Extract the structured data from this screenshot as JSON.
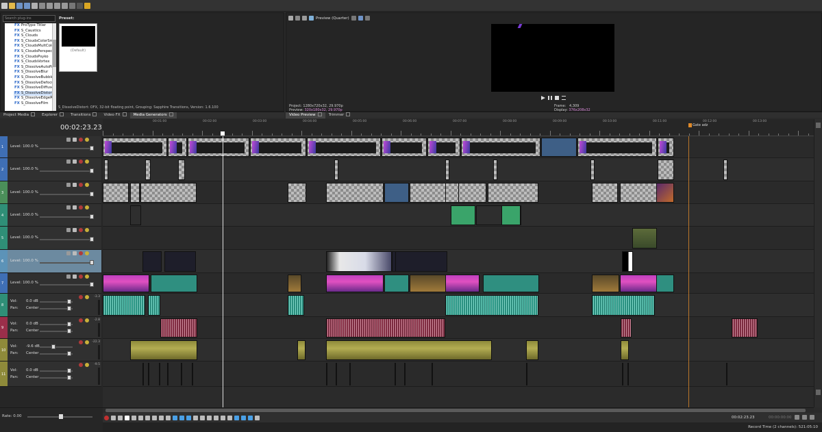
{
  "toolbar": {
    "icons": [
      "new-icon",
      "open-icon",
      "save-icon",
      "save-as-icon",
      "render-icon",
      "properties-icon",
      "cut-icon",
      "copy-icon",
      "paste-icon",
      "undo-icon",
      "redo-icon",
      "edit-tool-icon"
    ]
  },
  "explorer": {
    "search_placeholder": "Search plug-ins",
    "preset_label": "Preset:",
    "preset_thumb_label": "(Default)",
    "items": [
      "ProType Titler",
      "S_Caustics",
      "S_Clouds",
      "S_CloudsColorSmo",
      "S_CloudsMultColo",
      "S_CloudsPerspecti",
      "S_CloudsPsyko",
      "S_CloudsVortex",
      "S_DissolveAutoPai",
      "S_DissolveBlur",
      "S_DissolveBubble",
      "S_DissolveDefocu",
      "S_DissolveDiffuse",
      "S_DissolveDistort",
      "S_DissolveEdgeRa",
      "S_DissolveFilm"
    ],
    "selected_item": "S_DissolveDistort",
    "fx_prefix": "FX",
    "status": "S_DissolveDistort: OFX, 32-bit floating point, Grouping: Sapphire Transitions, Version: 1.6.100",
    "tabs": [
      "Project Media",
      "Explorer",
      "Transitions",
      "Video FX",
      "Media Generators"
    ]
  },
  "preview": {
    "mode": "Preview (Quarter)",
    "project_label": "Project:",
    "project_value": "1280x720x32, 29.970p",
    "preview_label": "Preview:",
    "preview_value": "320x180x32, 29.970p",
    "frame_label": "Frame:",
    "frame_value": "4,309",
    "display_label": "Display:",
    "display_value": "376x208x32",
    "tabs": [
      "Video Preview",
      "Trimmer"
    ]
  },
  "timeline": {
    "timecode": "00:02:23.23",
    "marker_label": "Gate adz",
    "ruler_labels": [
      "00:01:00",
      "00:02:00",
      "00:03:00",
      "00:04:00",
      "00:05:00",
      "00:06:00",
      "00:07:00",
      "00:08:00",
      "00:09:00",
      "00:10:00",
      "00:11:00",
      "00:12:00",
      "00:13:00"
    ],
    "video_tracks": [
      {
        "num": "1",
        "level": "Level: 100.0 %",
        "color": "#3f6fb5"
      },
      {
        "num": "2",
        "level": "Level: 100.0 %",
        "color": "#3f6fb5"
      },
      {
        "num": "3",
        "level": "Level: 100.0 %",
        "color": "#4b8f5a"
      },
      {
        "num": "4",
        "level": "Level: 100.0 %",
        "color": "#2f8f77"
      },
      {
        "num": "5",
        "level": "Level: 100.0 %",
        "color": "#2f8f77"
      },
      {
        "num": "6",
        "level": "Level: 100.0 %",
        "color": "#5c93b8"
      },
      {
        "num": "7",
        "level": "Level: 100.0 %",
        "color": "#3f6fb5"
      }
    ],
    "audio_tracks": [
      {
        "num": "8",
        "vol": "0.0 dB",
        "pan": "Center",
        "meter": "-3.3",
        "color": "#2f8f77"
      },
      {
        "num": "9",
        "vol": "0.0 dB",
        "pan": "Center",
        "meter": "-2.8",
        "color": "#9b2f4a"
      },
      {
        "num": "10",
        "vol": "-9.6 dB",
        "pan": "Center",
        "meter": "-22.3",
        "color": "#8e8a3a"
      },
      {
        "num": "11",
        "vol": "0.0 dB",
        "pan": "Center",
        "meter": "-9.5",
        "color": "#8e8a3a"
      }
    ],
    "vol_label": "Vol:",
    "pan_label": "Pan:"
  },
  "transport": {
    "rate": "Rate: 0.00",
    "cursor_time": "00:02:23.23",
    "end_time": "00:00:00:00",
    "status": "Record Time (2 channels): 521:05:10"
  },
  "colors": {
    "accent": "#4aa0e6",
    "playhead": "#ffffff",
    "marker": "#e08a2a"
  }
}
